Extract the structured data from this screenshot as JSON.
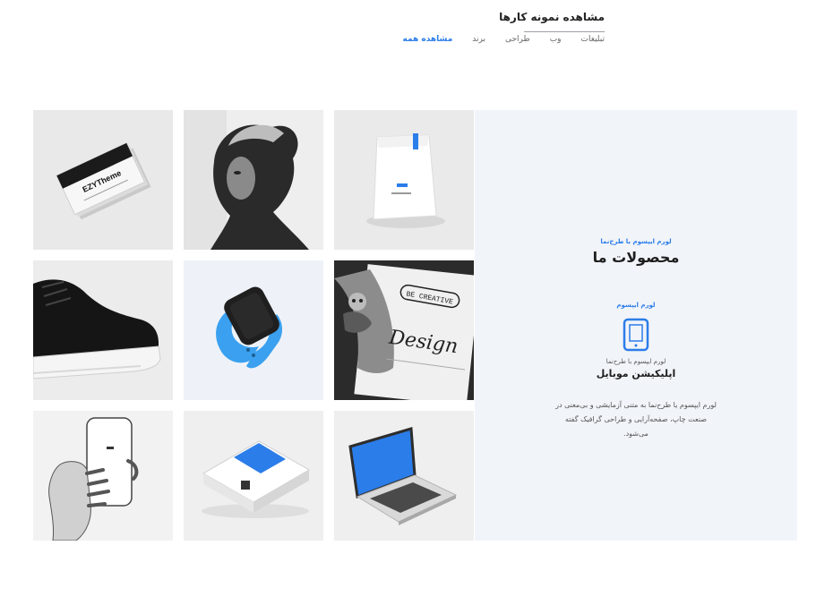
{
  "header": {
    "title": "مشاهده نمونه کارها",
    "filters": [
      {
        "label": "مشاهده همه",
        "active": true
      },
      {
        "label": "برند",
        "active": false
      },
      {
        "label": "طراحی",
        "active": false
      },
      {
        "label": "وب",
        "active": false
      },
      {
        "label": "تبلیغات",
        "active": false
      }
    ]
  },
  "portfolio": {
    "tiles": [
      {
        "icon": "business-cards-image",
        "text": "EZYTheme"
      },
      {
        "icon": "portrait-image"
      },
      {
        "icon": "coffee-bag-image"
      },
      {
        "icon": "sneaker-image"
      },
      {
        "icon": "smartwatch-image"
      },
      {
        "icon": "design-tattoo-image",
        "text_top": "BE CREATIVE",
        "text_main": "Design"
      },
      {
        "icon": "phone-in-hand-image"
      },
      {
        "icon": "book-mockup-image"
      },
      {
        "icon": "laptop-image"
      }
    ]
  },
  "panel": {
    "kicker": "لورم ایپسوم با طرح‌نما",
    "heading": "محصولات ما",
    "sub": "لورم ایپسوم",
    "icon": "tablet-icon",
    "label": "لورم ایپسوم با طرح‌نما",
    "feature": "اپلیکیشن موبایل",
    "description": "لورم ایپسوم یا طرح‌نما به متنی آزمایشی و بی‌معنی در صنعت چاپ، صفحه‌آرایی و طراحی گرافیک گفته می‌شود.",
    "accent_color": "#2b7de9"
  }
}
